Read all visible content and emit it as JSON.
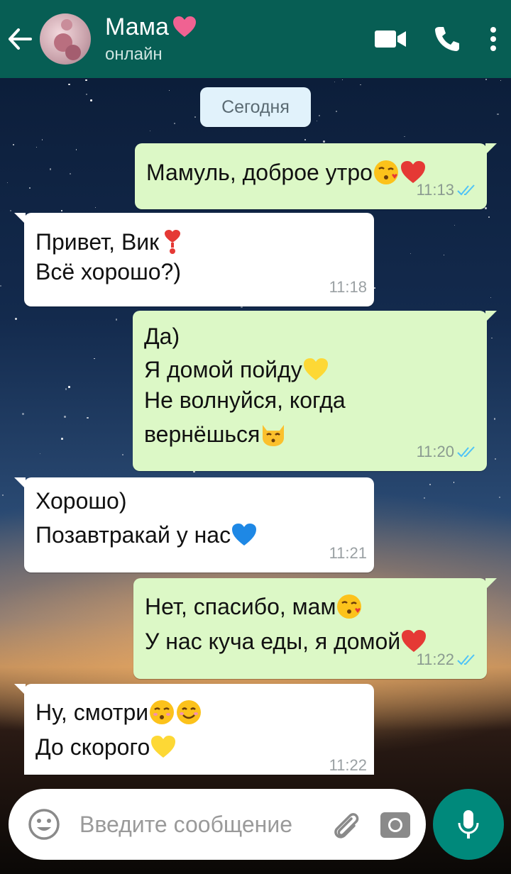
{
  "header": {
    "contact_name": "Мама",
    "status": "онлайн"
  },
  "chat": {
    "date_chip": "Сегодня",
    "messages": [
      {
        "dir": "out",
        "lines": [
          "Мамуль, доброе утро"
        ],
        "time": "11:13",
        "emoji": [
          "kiss-face",
          "red-heart"
        ]
      },
      {
        "dir": "in",
        "lines": [
          "Привет, Вик",
          "Всё хорошо?)"
        ],
        "time": "11:18",
        "emoji": [
          "heart-exclamation"
        ]
      },
      {
        "dir": "out",
        "lines": [
          "Да)",
          "Я домой пойду",
          "Не волнуйся, когда",
          "вернёшься"
        ],
        "time": "11:20",
        "emoji": [
          "yellow-heart",
          "kissing-cat"
        ]
      },
      {
        "dir": "in",
        "lines": [
          "Хорошо)",
          "Позавтракай у нас"
        ],
        "time": "11:21",
        "emoji": [
          "blue-heart"
        ]
      },
      {
        "dir": "out",
        "lines": [
          "Нет, спасибо, мам",
          "У нас куча еды, я домой"
        ],
        "time": "11:22",
        "emoji": [
          "kiss-face",
          "red-heart"
        ]
      },
      {
        "dir": "in",
        "lines": [
          "Ну, смотри",
          "До скорого"
        ],
        "time": "11:22",
        "emoji": [
          "kissing-smiling-eyes",
          "smiling-face",
          "yellow-heart"
        ]
      }
    ]
  },
  "input": {
    "placeholder": "Введите сообщение"
  },
  "colors": {
    "header_bg": "#075e54",
    "outgoing_bubble": "#dcf8c6",
    "incoming_bubble": "#ffffff",
    "read_ticks": "#4fc3f7",
    "mic_button": "#00897b"
  },
  "icons": [
    "back-arrow-icon",
    "video-call-icon",
    "phone-icon",
    "more-vert-icon",
    "emoji-icon",
    "attach-icon",
    "camera-icon",
    "mic-icon"
  ]
}
